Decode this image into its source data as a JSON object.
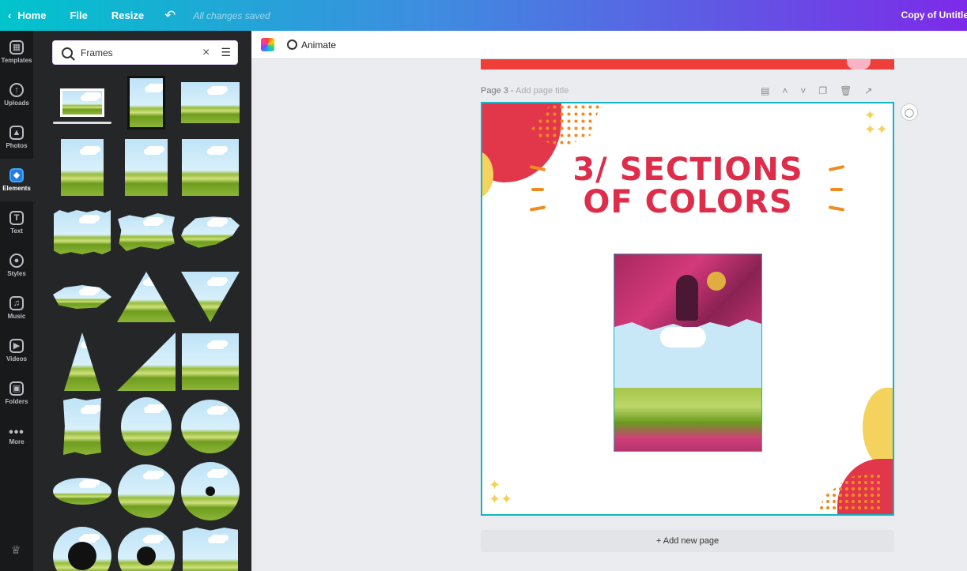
{
  "topbar": {
    "home": "Home",
    "file": "File",
    "resize": "Resize",
    "undo_icon": "undo-icon",
    "status": "All changes saved",
    "doc_title": "Copy of Untitle"
  },
  "rail": {
    "items": [
      {
        "label": "Templates",
        "icon": "templates-icon"
      },
      {
        "label": "Uploads",
        "icon": "uploads-icon"
      },
      {
        "label": "Photos",
        "icon": "photos-icon"
      },
      {
        "label": "Elements",
        "icon": "elements-icon",
        "active": true
      },
      {
        "label": "Text",
        "icon": "text-icon"
      },
      {
        "label": "Styles",
        "icon": "styles-icon"
      },
      {
        "label": "Music",
        "icon": "music-icon"
      },
      {
        "label": "Videos",
        "icon": "videos-icon"
      },
      {
        "label": "Folders",
        "icon": "folders-icon"
      },
      {
        "label": "More",
        "icon": "more-icon"
      }
    ]
  },
  "search": {
    "value": "Frames",
    "placeholder": "Frames"
  },
  "toolbar": {
    "animate": "Animate"
  },
  "page": {
    "label": "Page 3 -",
    "title_placeholder": "Add page title",
    "headline": "3/ SECTIONS OF COLORS"
  },
  "add_page": "+ Add new page",
  "colors": {
    "accent_teal": "#13b5c5",
    "headline_red": "#dd2d4a",
    "blob_red": "#e2374a",
    "blob_yellow": "#f4d25d",
    "dots_orange": "#f08c1f"
  }
}
